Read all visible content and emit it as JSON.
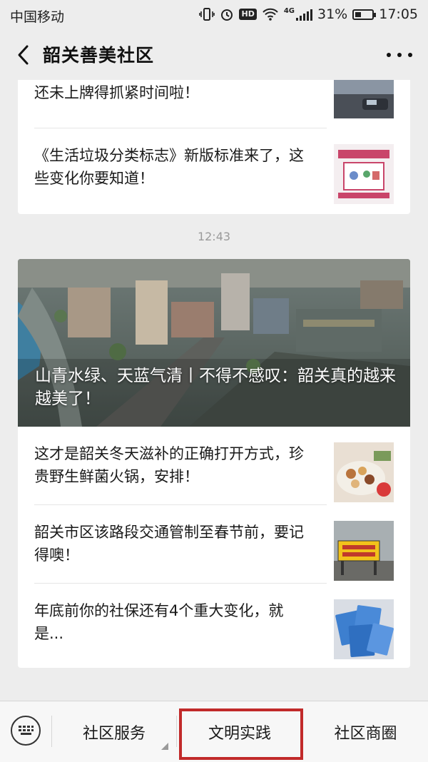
{
  "status_bar": {
    "carrier": "中国移动",
    "battery": "31%",
    "time": "17:05",
    "hd": "HD",
    "network": "4G"
  },
  "nav": {
    "title": "韶关善美社区"
  },
  "top_card": {
    "items": [
      {
        "title": "还未上牌得抓紧时间啦！",
        "thumb": "car-thumbnail"
      },
      {
        "title": "《生活垃圾分类标志》新版标准来了，这些变化你要知道！",
        "thumb": "garbage-sorting-thumbnail"
      }
    ]
  },
  "timestamp": "12:43",
  "main_card": {
    "hero_title": "山青水绿、天蓝气清丨不得不感叹：韶关真的越来越美了！",
    "items": [
      {
        "title": "这才是韶关冬天滋补的正确打开方式，珍贵野生鲜菌火锅，安排！",
        "thumb": "hotpot-thumbnail"
      },
      {
        "title": "韶关市区该路段交通管制至春节前，要记得噢！",
        "thumb": "road-closed-sign-thumbnail"
      },
      {
        "title": "年底前你的社保还有4个重大变化，就是...",
        "thumb": "social-security-cards-thumbnail"
      }
    ]
  },
  "menu": {
    "items": [
      "社区服务",
      "文明实践",
      "社区商圈"
    ]
  },
  "colors": {
    "background": "#ededed",
    "highlight": "#c12a2a",
    "card": "#ffffff"
  }
}
